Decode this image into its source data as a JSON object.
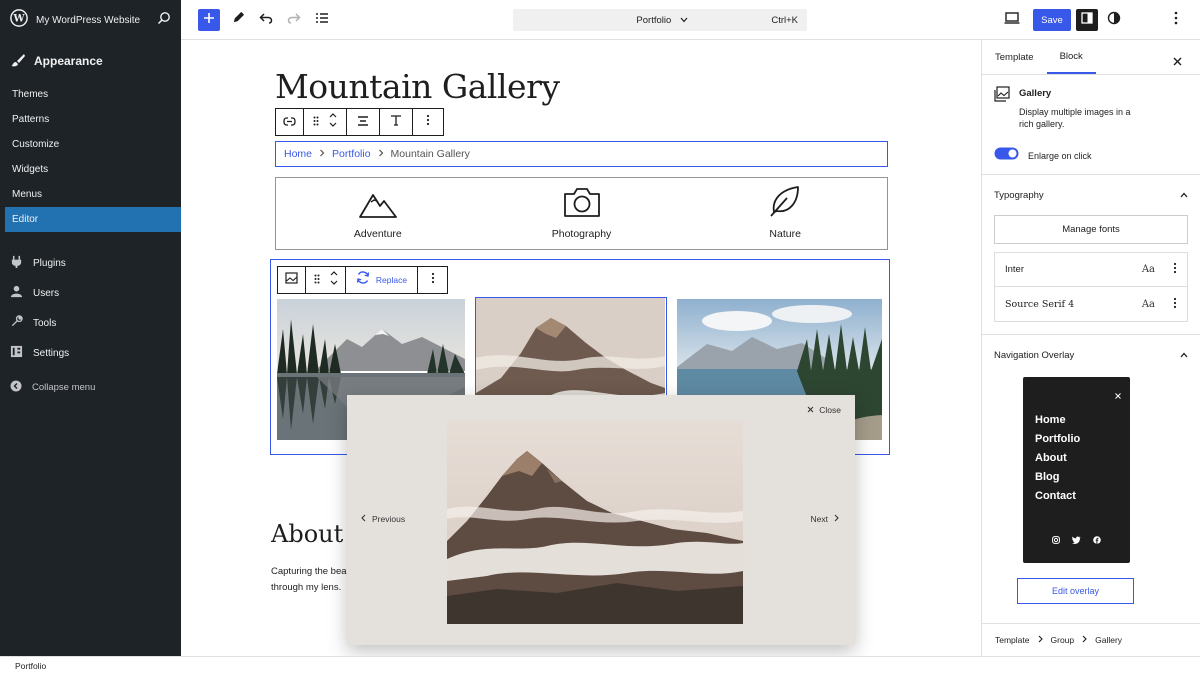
{
  "admin": {
    "site_name": "My WordPress Website",
    "section": "Appearance",
    "submenu": [
      "Themes",
      "Patterns",
      "Customize",
      "Widgets",
      "Menus",
      "Editor"
    ],
    "items": [
      "Plugins",
      "Users",
      "Tools",
      "Settings"
    ],
    "collapse": "Collapse menu"
  },
  "toolbar": {
    "command_title": "Portfolio",
    "shortcut": "Ctrl+K",
    "save_label": "Save"
  },
  "canvas": {
    "title": "Mountain Gallery",
    "breadcrumb": [
      "Home",
      "Portfolio",
      "Mountain Gallery"
    ],
    "categories": [
      "Adventure",
      "Photography",
      "Nature"
    ],
    "replace_label": "Replace",
    "about_title": "About t",
    "about_lines": [
      "Capturing the beau",
      "through my lens."
    ]
  },
  "lightbox": {
    "close_label": "Close",
    "prev_label": "Previous",
    "next_label": "Next"
  },
  "panel": {
    "tabs": [
      "Template",
      "Block"
    ],
    "block_name": "Gallery",
    "block_desc_1": "Display multiple images in a",
    "block_desc_2": "rich gallery.",
    "toggle_label": "Enlarge on click",
    "toggle_on": true,
    "typography_title": "Typography",
    "manage_fonts": "Manage fonts",
    "fonts": [
      {
        "name": "Inter",
        "preview": "Aa"
      },
      {
        "name": "Source Serif 4",
        "preview": "Aa"
      }
    ],
    "nav_overlay_title": "Navigation Overlay",
    "overlay_menu": [
      "Home",
      "Portfolio",
      "About",
      "Blog",
      "Contact"
    ],
    "edit_overlay": "Edit overlay",
    "footer_breadcrumb": [
      "Template",
      "Group",
      "Gallery"
    ]
  },
  "status": {
    "label": "Portfolio"
  },
  "colors": {
    "accent": "#3858e9",
    "admin_bg": "#1d2327",
    "admin_active": "#2271b1",
    "lightbox_bg": "#e4e1dd"
  }
}
